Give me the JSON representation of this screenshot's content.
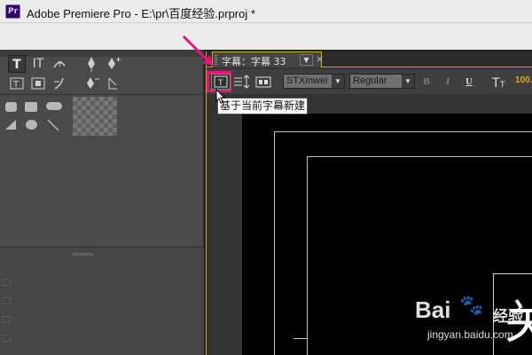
{
  "app": {
    "logo": "Pr",
    "window_title": "Adobe Premiere Pro - E:\\pr\\百度经验.prproj *"
  },
  "tools": {
    "row1": [
      "T",
      "IT",
      "path-type-icon",
      "pen-icon",
      "add-anchor-icon"
    ],
    "row2": [
      "area-type-icon",
      "vertical-area-type-icon",
      "vertical-path-type-icon",
      "delete-anchor-icon",
      "convert-anchor-icon"
    ],
    "shapes": [
      "rectangle",
      "rounded-rectangle",
      "rounded-corner-rectangle",
      "wedge",
      "ellipse",
      "line"
    ]
  },
  "editor": {
    "tab_label": "字幕：字幕 33",
    "tab_menu_glyph": "▼",
    "tab_close_glyph": "×",
    "toolbar": {
      "new_from_current_icon": "new-title-based-on-current-icon",
      "font_family": "STXinwei",
      "font_style": "Regular",
      "bold": "B",
      "italic": "I",
      "underline": "U",
      "font_size": "100."
    },
    "tooltip": "基于当前字幕新建",
    "canvas_glyph": "关"
  },
  "colors": {
    "accent_highlight": "#e8147b",
    "panel_focus": "#d7a51b"
  },
  "watermark": {
    "brand_prefix": "Bai",
    "brand_suffix": "经验",
    "url": "jingyan.baidu.com"
  }
}
